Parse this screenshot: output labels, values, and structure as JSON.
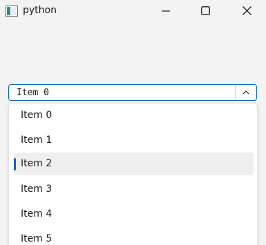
{
  "window": {
    "title": "python",
    "app_icon": "python-window-icon"
  },
  "controls": {
    "minimize_icon": "minimize-icon",
    "maximize_icon": "maximize-icon",
    "close_icon": "close-icon"
  },
  "combobox": {
    "current_value": "Item 0",
    "arrow_icon": "chevron-up-icon"
  },
  "dropdown": {
    "items": [
      {
        "label": "Item 0"
      },
      {
        "label": "Item 1"
      },
      {
        "label": "Item 2"
      },
      {
        "label": "Item 3"
      },
      {
        "label": "Item 4"
      },
      {
        "label": "Item 5"
      }
    ],
    "highlighted_index": 2
  },
  "colors": {
    "accent": "#0067c0",
    "background": "#f3f3f3",
    "highlight": "#efefef"
  }
}
